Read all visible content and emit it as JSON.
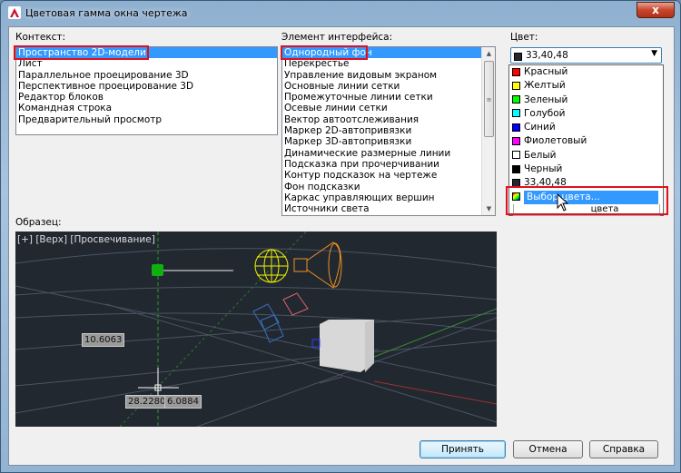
{
  "window": {
    "title": "Цветовая гамма окна чертежа",
    "close_label": "x"
  },
  "context": {
    "label": "Контекст:",
    "items": [
      "Пространство 2D-модели",
      "Лист",
      "Параллельное проецирование 3D",
      "Перспективное проецирование 3D",
      "Редактор блоков",
      "Командная строка",
      "Предварительный просмотр"
    ],
    "selected": "Пространство 2D-модели"
  },
  "interface_element": {
    "label": "Элемент интерфейса:",
    "items": [
      "Однородный фон",
      "Перекрестье",
      "Управление видовым экраном",
      "Основные линии сетки",
      "Промежуточные линии сетки",
      "Осевые линии сетки",
      "Вектор автоотслеживания",
      "Маркер 2D-автопривязки",
      "Маркер 3D-автопривязки",
      "Динамические размерные линии",
      "Подсказка при прочерчивании",
      "Контур подсказок на чертеже",
      "Фон подсказки",
      "Каркас управляющих вершин",
      "Источники света"
    ],
    "selected": "Однородный фон"
  },
  "color": {
    "label": "Цвет:",
    "value": "33,40,48",
    "value_swatch": "#212830",
    "options": [
      {
        "label": "Красный",
        "swatch": "#ff0000"
      },
      {
        "label": "Желтый",
        "swatch": "#ffff00"
      },
      {
        "label": "Зеленый",
        "swatch": "#00ff00"
      },
      {
        "label": "Голубой",
        "swatch": "#00ffff"
      },
      {
        "label": "Синий",
        "swatch": "#0000ff"
      },
      {
        "label": "Фиолетовый",
        "swatch": "#ff00ff"
      },
      {
        "label": "Белый",
        "swatch": "#ffffff"
      },
      {
        "label": "Черный",
        "swatch": "#000000"
      },
      {
        "label": "33,40,48",
        "swatch": "#212830"
      },
      {
        "label": "Выбор цвета...",
        "swatch": "multicolor"
      }
    ],
    "highlighted": "Выбор цвета...",
    "behind_button_text": "цвета"
  },
  "preview": {
    "label": "Образец:",
    "viewport_label": "[+] [Верх] [Просвечивание]",
    "dim_1": "10.6063",
    "coord_x": "28.2280",
    "coord_y": "6.0884"
  },
  "buttons": {
    "ok": "Принять",
    "cancel": "Отмена",
    "help": "Справка"
  },
  "colors": {
    "selection": "#3399ff",
    "highlight_box": "#e0101c",
    "background": "#212830"
  }
}
